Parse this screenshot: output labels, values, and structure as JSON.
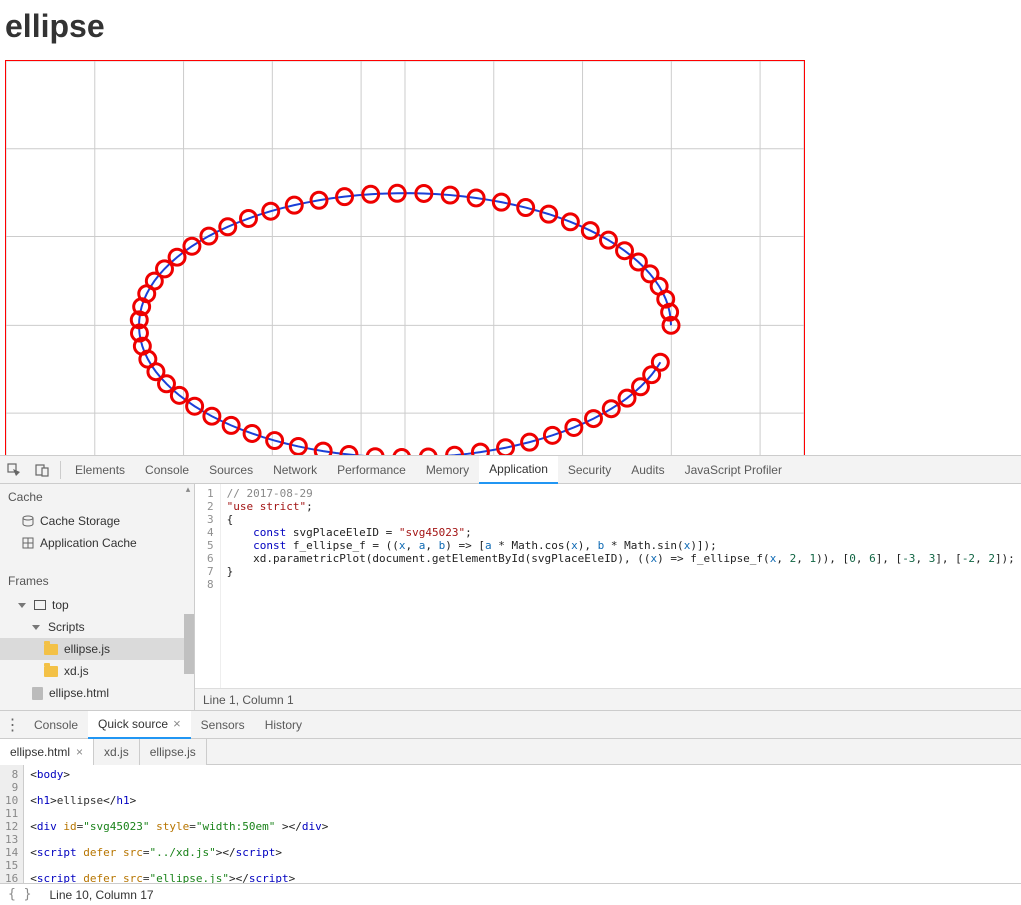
{
  "page": {
    "title": "ellipse"
  },
  "devtools": {
    "tabs": [
      "Elements",
      "Console",
      "Sources",
      "Network",
      "Performance",
      "Memory",
      "Application",
      "Security",
      "Audits",
      "JavaScript Profiler"
    ],
    "activeTab": "Application",
    "sidebar": {
      "cache": {
        "title": "Cache",
        "items": [
          "Cache Storage",
          "Application Cache"
        ]
      },
      "frames": {
        "title": "Frames",
        "top": "top",
        "scripts": "Scripts",
        "files": [
          "ellipse.js",
          "xd.js"
        ],
        "htmlFile": "ellipse.html"
      }
    },
    "editor": {
      "status": "Line 1, Column 1",
      "lines": [
        {
          "n": 1,
          "type": "comment",
          "text": "// 2017-08-29"
        },
        {
          "n": 2,
          "type": "str",
          "text": "\"use strict\"",
          "suffix": ";"
        },
        {
          "n": 3,
          "type": "plain",
          "text": "{"
        },
        {
          "n": 4,
          "type": "const1"
        },
        {
          "n": 5,
          "type": "const2"
        },
        {
          "n": 6,
          "type": "call"
        },
        {
          "n": 7,
          "type": "plain",
          "text": "}"
        },
        {
          "n": 8,
          "type": "empty"
        }
      ]
    }
  },
  "drawer": {
    "tabs": [
      "Console",
      "Quick source",
      "Sensors",
      "History"
    ],
    "activeTab": "Quick source",
    "fileTabs": [
      "ellipse.html",
      "xd.js",
      "ellipse.js"
    ],
    "activeFile": "ellipse.html",
    "status": "Line 10, Column 17",
    "startLine": 8
  },
  "chart_data": {
    "type": "scatter",
    "title": "ellipse",
    "parametric": "[a*cos(t), b*sin(t)] with a=2, b=1",
    "t_range": [
      0,
      6
    ],
    "xlim": [
      -3,
      3
    ],
    "ylim": [
      -2,
      2
    ],
    "series": [
      {
        "name": "ellipse",
        "a": 2,
        "b": 1,
        "t_start": 0,
        "t_end": 6,
        "points_approx": 60
      }
    ]
  }
}
